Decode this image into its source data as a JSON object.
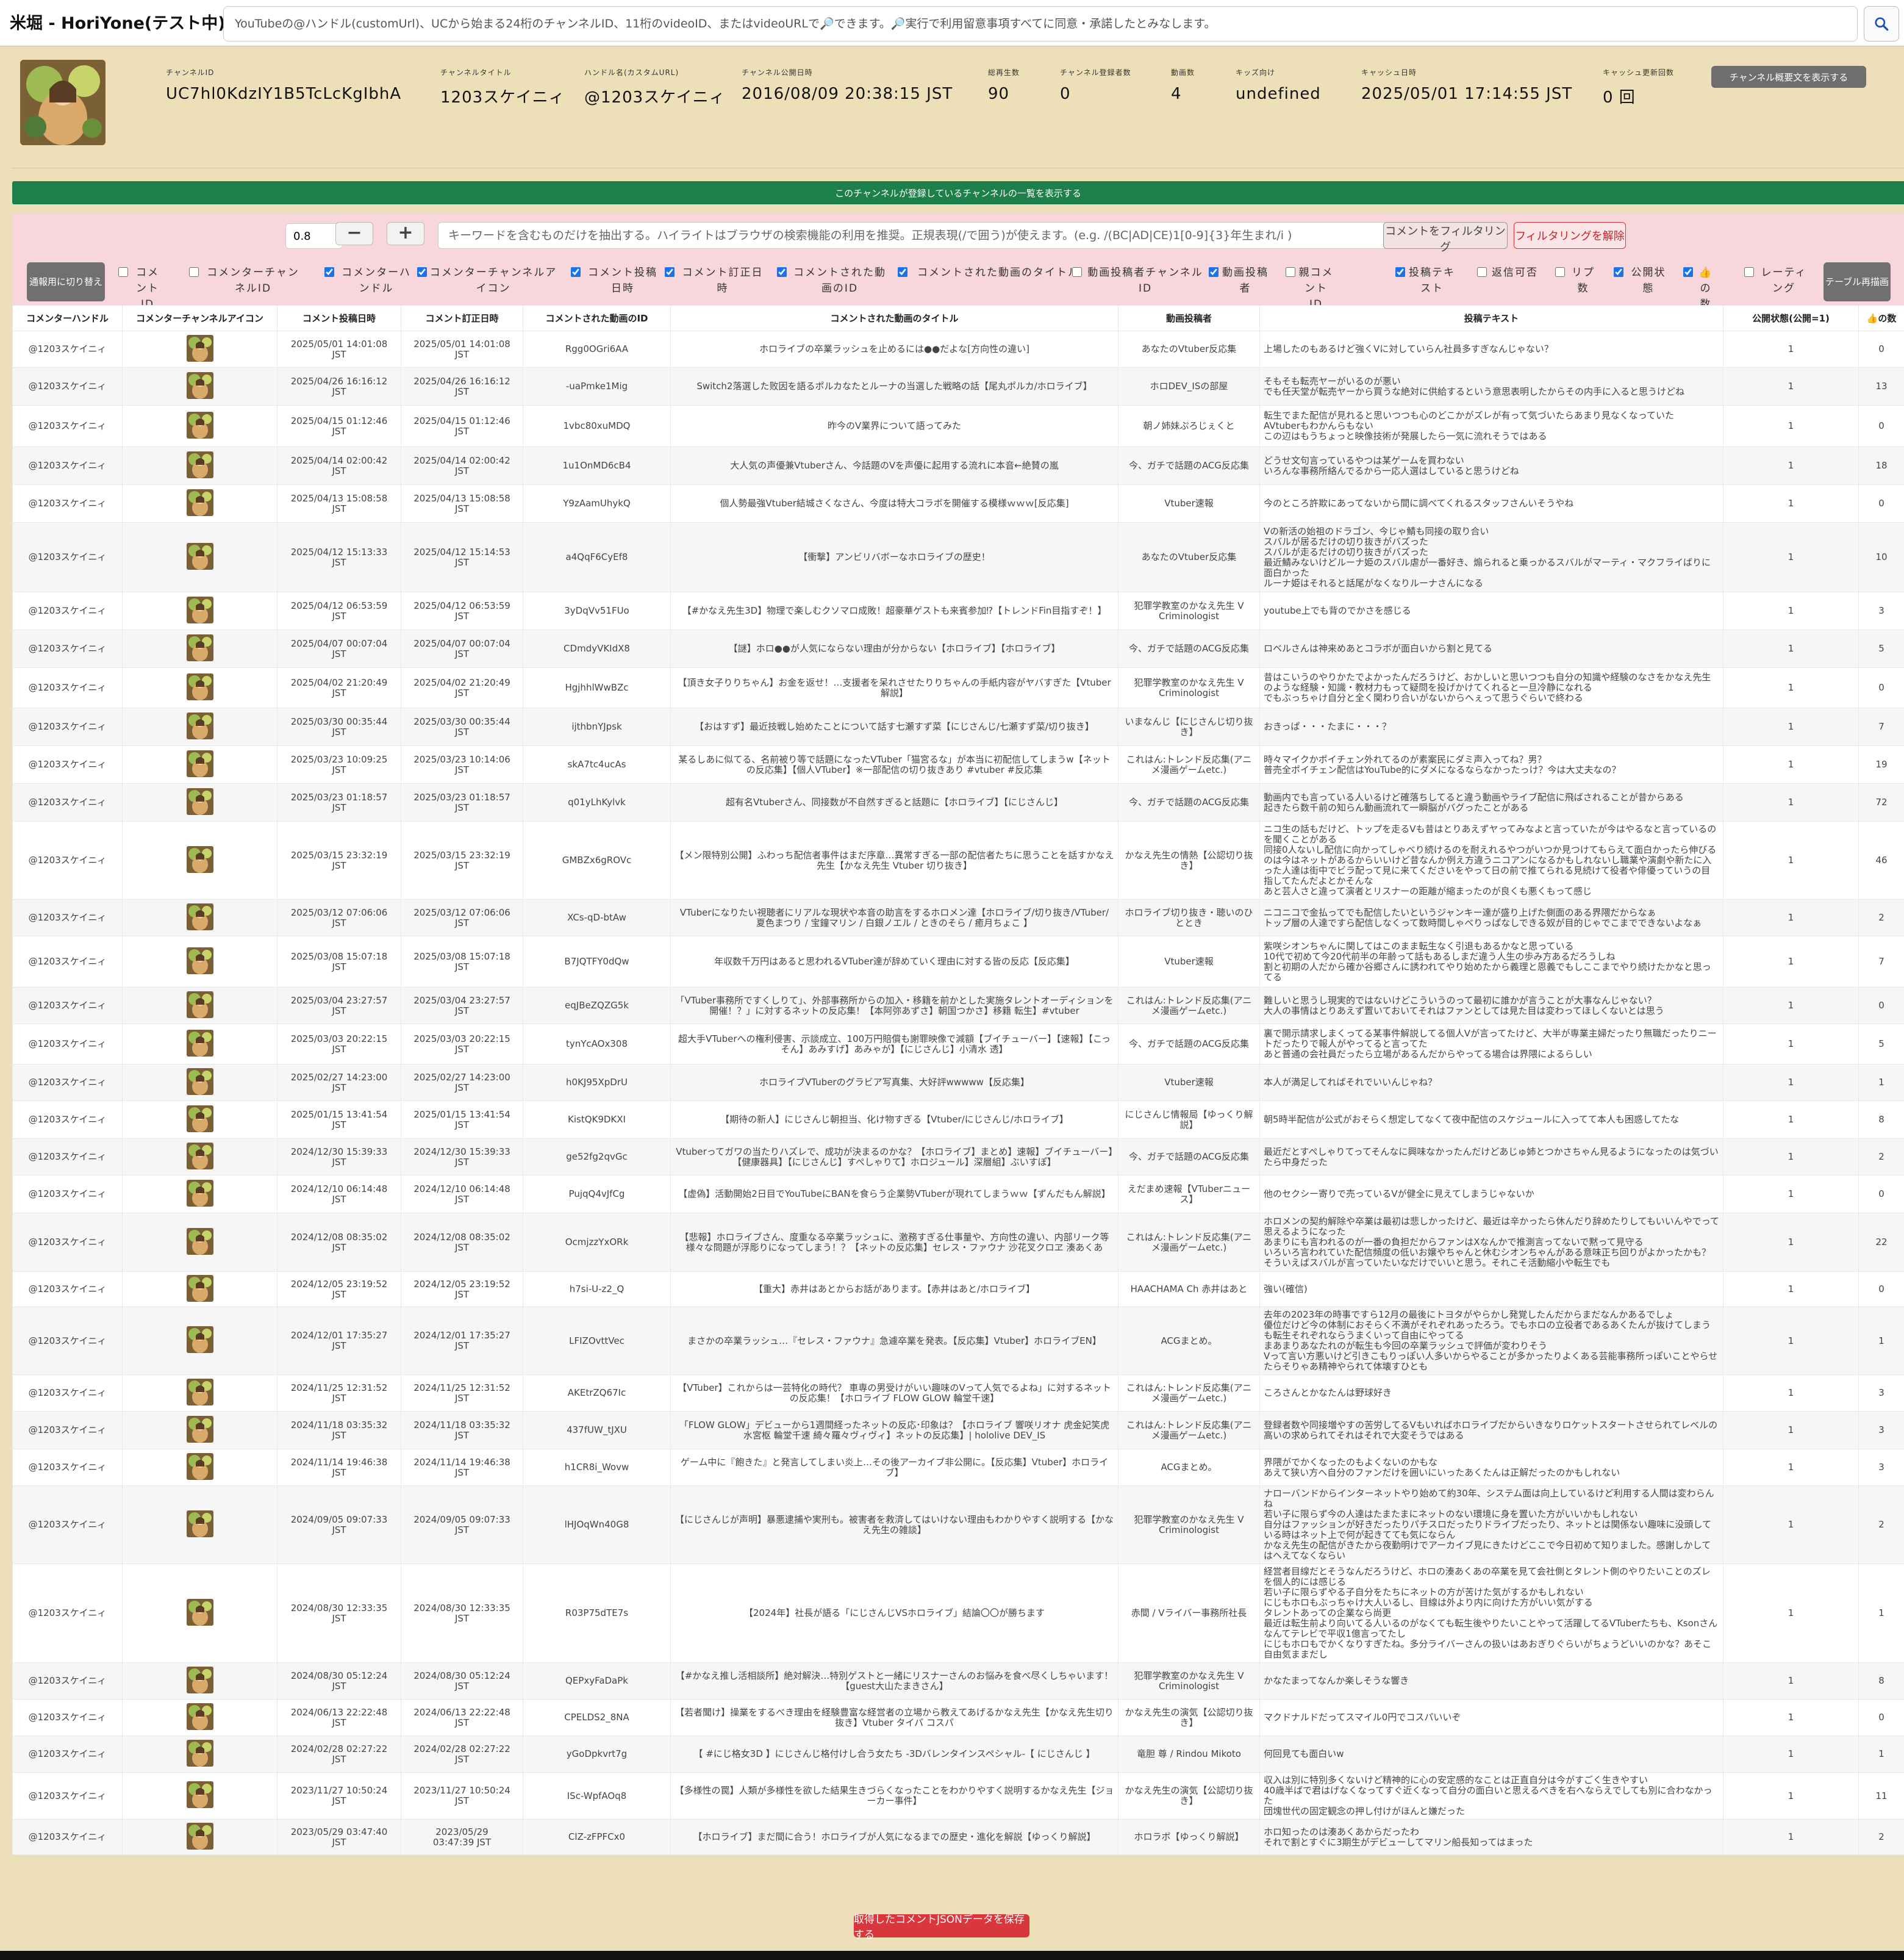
{
  "app": {
    "title": "米堀 - HoriYone(テスト中)"
  },
  "search": {
    "placeholder": "YouTubeの@ハンドル(customUrl)、UCから始まる24桁のチャンネルID、11桁のvideoID、またはvideoURLで🔎できます。🔎実行で利用留意事項すべてに同意・承諾したとみなします。",
    "icon": "search-icon"
  },
  "channel": {
    "fields": [
      {
        "label": "チャンネルID",
        "value": "UC7hl0KdzIY1B5TcLcKgIbhA"
      },
      {
        "label": "チャンネルタイトル",
        "value": "1203スケイニィ"
      },
      {
        "label": "ハンドル名(カスタムURL)",
        "value": "@1203スケイニィ"
      },
      {
        "label": "チャンネル公開日時",
        "value": "2016/08/09 20:38:15 JST"
      },
      {
        "label": "総再生数",
        "value": "90"
      },
      {
        "label": "チャンネル登録者数",
        "value": "0"
      },
      {
        "label": "動画数",
        "value": "4"
      },
      {
        "label": "キッズ向け",
        "value": "undefined"
      },
      {
        "label": "キャッシュ日時",
        "value": "2025/05/01 17:14:55 JST"
      },
      {
        "label": "キャッシュ更新回数",
        "value": "0 回"
      }
    ],
    "summary_button": "チャンネル概要文を表示する"
  },
  "subscriptions_bar": "このチャンネルが登録しているチャンネルの一覧を表示する",
  "filter": {
    "threshold": "0.8",
    "minus": "−",
    "plus": "+",
    "keyword_placeholder": "キーワードを含むものだけを抽出する。ハイライトはブラウザの検索機能の利用を推奨。正規表現(/で囲う)が使えます。(e.g. /(BC|AD|CE)1[0-9]{3}年生まれ/i )",
    "filter_button": "コメントをフィルタリング",
    "unfilter_button": "フィルタリングを解除",
    "print_button": "通報用に切り替え",
    "redraw_button": "テーブル再描画"
  },
  "column_toggles": [
    {
      "label": "コメントID",
      "checked": false
    },
    {
      "label": "コメンターチャンネルID",
      "checked": false
    },
    {
      "label": "コメンターハンドル",
      "checked": true
    },
    {
      "label": "コメンターチャンネルアイコン",
      "checked": true
    },
    {
      "label": "コメント投稿日時",
      "checked": true
    },
    {
      "label": "コメント訂正日時",
      "checked": true
    },
    {
      "label": "コメントされた動画のID",
      "checked": true
    },
    {
      "label": "コメントされた動画のタイトル",
      "checked": true
    },
    {
      "label": "動画投稿者チャンネルID",
      "checked": false
    },
    {
      "label": "動画投稿者",
      "checked": true
    },
    {
      "label": "親コメントID",
      "checked": false
    },
    {
      "label": "投稿テキスト",
      "checked": true
    },
    {
      "label": "返信可否",
      "checked": false
    },
    {
      "label": "リプ数",
      "checked": false
    },
    {
      "label": "公開状態",
      "checked": true
    },
    {
      "label": "👍の数",
      "checked": true
    },
    {
      "label": "レーティング",
      "checked": false
    }
  ],
  "table": {
    "headers": [
      "コメンターハンドル",
      "コメンターチャンネルアイコン",
      "コメント投稿日時",
      "コメント訂正日時",
      "コメントされた動画のID",
      "コメントされた動画のタイトル",
      "動画投稿者",
      "投稿テキスト",
      "公開状態(公開=1)",
      "👍の数"
    ],
    "rows": [
      {
        "handle": "@1203スケイニィ",
        "posted": "2025/05/01 14:01:08\nJST",
        "edited": "2025/05/01 14:01:08\nJST",
        "edited_red": false,
        "vid": "Rgg0OGri6AA",
        "title": "ホロライブの卒業ラッシュを止めるには●●だよな[方向性の違い]",
        "uploader": "あなたのVtuber反応集",
        "text": "上場したのもあるけど強くVに対していらん社員多すぎなんじゃない？",
        "pub": "1",
        "likes": "0"
      },
      {
        "handle": "@1203スケイニィ",
        "posted": "2025/04/26 16:16:12\nJST",
        "edited": "2025/04/26 16:16:12\nJST",
        "edited_red": false,
        "vid": "-uaPmke1Mig",
        "title": "Switch2落選した败因を語るポルカなたとルーナの当選した戦略の話【尾丸ポルカ/ホロライブ】",
        "uploader": "ホロDEV_ISの部屋",
        "text": "そもそも転売ヤーがいるのが悪い\nでも任天堂が転売ヤーから買うな絶対に供給するという意思表明したからその内手に入ると思うけどね",
        "pub": "1",
        "likes": "13"
      },
      {
        "handle": "@1203スケイニィ",
        "posted": "2025/04/15 01:12:46\nJST",
        "edited": "2025/04/15 01:12:46\nJST",
        "edited_red": false,
        "vid": "1vbc80xuMDQ",
        "title": "昨今のV業界について語ってみた",
        "uploader": "朝ノ姉妹ぷろじぇくと",
        "text": "転生でまた配信が見れると思いつつも心のどこかがズレが有って気づいたらあまり見なくなっていた\nAVtuberもわかんらもない\nこの辺はもうちょっと映像技術が発展したら一気に流れそうではある",
        "pub": "1",
        "likes": "0"
      },
      {
        "handle": "@1203スケイニィ",
        "posted": "2025/04/14 02:00:42\nJST",
        "edited": "2025/04/14 02:00:42\nJST",
        "edited_red": false,
        "vid": "1u1OnMD6cB4",
        "title": "大人気の声優兼Vtuberさん、今話題のVを声優に起用する流れに本音←絶賛の嵐",
        "uploader": "今、ガチで話題のACG反応集",
        "text": "どうせ文句言っているやつは某ゲームを買わない\nいろんな事務所絡んでるから一応人選はしていると思うけどね",
        "pub": "1",
        "likes": "18"
      },
      {
        "handle": "@1203スケイニィ",
        "posted": "2025/04/13 15:08:58\nJST",
        "edited": "2025/04/13 15:08:58\nJST",
        "edited_red": false,
        "vid": "Y9zAamUhykQ",
        "title": "個人勢最強Vtuber結城さくなさん、今度は特大コラボを開催する模様ｗｗｗ[反応集]",
        "uploader": "Vtuber速報",
        "text": "今のところ許欺にあってないから間に調べてくれるスタッフさんいそうやね",
        "pub": "1",
        "likes": "0"
      },
      {
        "handle": "@1203スケイニィ",
        "posted": "2025/04/12 15:13:33\nJST",
        "edited": "2025/04/12 15:14:53\nJST",
        "edited_red": true,
        "vid": "a4QqF6CyEf8",
        "title": "【衝撃】アンビリバボーなホロライブの歴史！",
        "uploader": "あなたのVtuber反応集",
        "text": "Vの新活の始祖のドラゴン、今じゃ鯖も同接の取り合い\nスバルが居るだけの切り抜きがバズった\nスバルが走るだけの切り抜きがバズった\n最近鯖みないけどルーナ姫のスバル虐が一番好き、煽られると乗っかるスバルがマーティ・マクフライばりに面白かった\nルーナ姫はそれると話尾がなくなりルーナさんになる",
        "pub": "1",
        "likes": "10"
      },
      {
        "handle": "@1203スケイニィ",
        "posted": "2025/04/12 06:53:59\nJST",
        "edited": "2025/04/12 06:53:59\nJST",
        "edited_red": false,
        "vid": "3yDqVv51FUo",
        "title": "【#かなえ先生3D】物理で楽しむクソマロ成敗！超豪華ゲストも来賓参加⁉【トレンドFin目指すぞ！】",
        "uploader": "犯罪学教室のかなえ先生 V Criminologist",
        "text": "youtube上でも背のでかさを感じる",
        "pub": "1",
        "likes": "3"
      },
      {
        "handle": "@1203スケイニィ",
        "posted": "2025/04/07 00:07:04\nJST",
        "edited": "2025/04/07 00:07:04\nJST",
        "edited_red": false,
        "vid": "CDmdyVKIdX8",
        "title": "【謎】ホロ●●が人気にならない理由が分からない【ホロライブ】【ホロライブ】",
        "uploader": "今、ガチで話題のACG反応集",
        "text": "ロベルさんは神来めあとコラボが面白いから割と見てる",
        "pub": "1",
        "likes": "5"
      },
      {
        "handle": "@1203スケイニィ",
        "posted": "2025/04/02 21:20:49\nJST",
        "edited": "2025/04/02 21:20:49\nJST",
        "edited_red": false,
        "vid": "HgjhhlWwBZc",
        "title": "【頂き女子りりちゃん】お金を返せ！…支援者を呆れさせたりりちゃんの手紙内容がヤバすぎた【Vtuber解説】",
        "uploader": "犯罪学教室のかなえ先生 V Criminologist",
        "text": "昔はこいうのやりかたでよかったんだろうけど、おかしいと思いつつも自分の知識や経験のなさをかなえ先生のような経験・知識・教材力もって疑問を投げかけてくれると一旦冷静になれる\nでもぶっちゃけ自分と全く関わり合いがないからへぇって思うぐらいで終わる",
        "pub": "1",
        "likes": "0"
      },
      {
        "handle": "@1203スケイニィ",
        "posted": "2025/03/30 00:35:44\nJST",
        "edited": "2025/03/30 00:35:44\nJST",
        "edited_red": false,
        "vid": "ijthbnYJpsk",
        "title": "【おはすず】最近技戦し始めたことについて話す七瀬すず菜【にじさんじ/七瀬すず菜/切り抜き】",
        "uploader": "いまなんじ【にじさんじ切り抜き】",
        "text": "おきっぱ・・・たまに・・・？",
        "pub": "1",
        "likes": "7"
      },
      {
        "handle": "@1203スケイニィ",
        "posted": "2025/03/23 10:09:25\nJST",
        "edited": "2025/03/23 10:14:06\nJST",
        "edited_red": true,
        "vid": "skA7tc4ucAs",
        "title": "某るしあに似てる、名前被り等で話題になったVTuber「猫宮るな」が本当に初配信してしまうw【ネットの反応集】【個人VTuber】※一部配信の切り抜きあり #vtuber #反応集",
        "uploader": "これはん:トレンド反応集(アニメ漫画ゲームetc.)",
        "text": "時々マイクかポイチェン外れてるのが素案民にダミ声入ってね？男？\n普売全ポイチェン配信はYouTube的にダメになるならなかったっけ？今は大丈夫なの？",
        "pub": "1",
        "likes": "19"
      },
      {
        "handle": "@1203スケイニィ",
        "posted": "2025/03/23 01:18:57\nJST",
        "edited": "2025/03/23 01:18:57\nJST",
        "edited_red": false,
        "vid": "q01yLhKylvk",
        "title": "超有名Vtuberさん、同接数が不自然すぎると話題に【ホロライブ】【にじさんじ】",
        "uploader": "今、ガチで話題のACG反応集",
        "text": "動画内でも言っている人いるけど確落ちしてると違う動画やライブ配信に飛ばされることが昔からある\n起きたら数千前の知らん動画流れて一瞬脳がバグったことがある",
        "pub": "1",
        "likes": "72"
      },
      {
        "handle": "@1203スケイニィ",
        "posted": "2025/03/15 23:32:19\nJST",
        "edited": "2025/03/15 23:32:19\nJST",
        "edited_red": false,
        "vid": "GMBZx6gROVc",
        "title": "【メン限特別公開】ふわっち配信者事件はまだ序章…異常すぎる一部の配信者たちに思うことを話すかなえ先生【かなえ先生 Vtuber 切り抜き】",
        "uploader": "かなえ先生の情熱【公認切り抜き】",
        "text": "ニコ生の話もだけど、トップを走るVも昔はとりあえずヤってみなよと言っていたが今はやるなと言っているのを聞くことがある\n同接0人ないし配信に向かってしゃべり続けるのを耐えれるやつがいつか見つけてもらえて面白かったら伸びるのは今はネットがあるからいいけど昔なんか例え方違うニコアンになるかもしれないし職業や演劇や新たに入った人達は街中でビラ配って見に来てくださいをやって日の前で推てられる見続けて役者や俳優っていうの目指してたんだよとかそんな\nあと芸人さと違って演者とリスナーの距離が縮まったのが良くも悪くもって感じ",
        "pub": "1",
        "likes": "46"
      },
      {
        "handle": "@1203スケイニィ",
        "posted": "2025/03/12 07:06:06\nJST",
        "edited": "2025/03/12 07:06:06\nJST",
        "edited_red": false,
        "vid": "XCs-qD-btAw",
        "title": "VTuberになりたい視聴者にリアルな現状や本音の助言をするホロメン達【ホロライブ/切り抜き/VTuber/ 夏色まつり / 宝鐘マリン / 白銀ノエル / ときのそら / 癒月ちょこ 】",
        "uploader": "ホロライブ切り抜き・聴いのひととき",
        "text": "ニコニコで金払ってでも配信したいというジャンキー達が盛り上げた側面のある界隈だからなぁ\nトップ層の人達ですら配信しなくって数時間しゃべりっぱなしできる奴が目的じゃでこまでできないよなぁ",
        "pub": "1",
        "likes": "2"
      },
      {
        "handle": "@1203スケイニィ",
        "posted": "2025/03/08 15:07:18\nJST",
        "edited": "2025/03/08 15:07:18\nJST",
        "edited_red": false,
        "vid": "B7JQTFY0dQw",
        "title": "年収数千万円はあると思われるVTuber達が辞めていく理由に対する皆の反応【反応集】",
        "uploader": "Vtuber速報",
        "text": "紫咲シオンちゃんに関してはこのまま転生なく引退もあるかなと思っている\n10代で初めて今20代前半の年齢って話もあるしまだ違う人生の歩み方あるだろうしね\n割と初期の人だから確か谷郷さんに誘われてやり始めたから義理と恩義でもしここまでやり続けたかなと思ってる",
        "pub": "1",
        "likes": "7"
      },
      {
        "handle": "@1203スケイニィ",
        "posted": "2025/03/04 23:27:57\nJST",
        "edited": "2025/03/04 23:27:57\nJST",
        "edited_red": false,
        "vid": "eqJBeZQZG5k",
        "title": "「VTuber事務所ですくしりて」、外部事務所からの加入・移籍を前かとした実施タレントオーディションを開催！？」に対するネットの反応集！【本阿弥あずさ】朝国つかさ】移籍 転生】#vtuber",
        "uploader": "これはん:トレンド反応集(アニメ漫画ゲームetc.)",
        "text": "難しいと思うし現実的ではないけどこういうのって最初に誰かが言うことが大事なんじゃない？\n大人の事情はとりあえず置いておいてそれはファンとしては見た目は変わってほしくないとは思う",
        "pub": "1",
        "likes": "0"
      },
      {
        "handle": "@1203スケイニィ",
        "posted": "2025/03/03 20:22:15\nJST",
        "edited": "2025/03/03 20:22:15\nJST",
        "edited_red": false,
        "vid": "tynYcAOx308",
        "title": "超大手VTuberへの権利侵害、示談成立、100万円賠償も謝罪映像で減額【ブイチューバー】【速報】【こっそん】あみすげ】あみゃが】【にじさんじ】小清水 透】",
        "uploader": "今、ガチで話題のACG反応集",
        "text": "裏で開示請求しまくってる某事件解説してる個人Vが言ってたけど、大半が専業主婦だったり無職だったりニートだったりで報人がやってると言ってた\nあと普通の会社員だったら立場があるんだからやってる場合は界隈によるらしい",
        "pub": "1",
        "likes": "5"
      },
      {
        "handle": "@1203スケイニィ",
        "posted": "2025/02/27 14:23:00\nJST",
        "edited": "2025/02/27 14:23:00\nJST",
        "edited_red": false,
        "vid": "h0KJ95XpDrU",
        "title": "ホロライブVTuberのグラビア写真集、大好評wwwww【反応集】",
        "uploader": "Vtuber速報",
        "text": "本人が満足してればそれでいいんじゃね？",
        "pub": "1",
        "likes": "1"
      },
      {
        "handle": "@1203スケイニィ",
        "posted": "2025/01/15 13:41:54\nJST",
        "edited": "2025/01/15 13:41:54\nJST",
        "edited_red": false,
        "vid": "KistQK9DKXI",
        "title": "【期待の新人】にじさんじ朝担当、化け物すぎる【Vtuber/にじさんじ/ホロライブ】",
        "uploader": "にじさんじ情報局【ゆっくり解説】",
        "text": "朝5時半配信が公式がおそらく想定してなくて夜中配信のスケジュールに入ってて本人も困惑してたな",
        "pub": "1",
        "likes": "8"
      },
      {
        "handle": "@1203スケイニィ",
        "posted": "2024/12/30 15:39:33\nJST",
        "edited": "2024/12/30 15:39:33\nJST",
        "edited_red": false,
        "vid": "ge52fg2qvGc",
        "title": "Vtuberってガワの当たりハズレで、成功が決まるのかな？【ホロライブ】まとめ】速報】ブイチューバー】【健康器具】【にじさんじ】すぺしゃりて】ホロジュール】深層組】ぶいすぽ】",
        "uploader": "今、ガチで話題のACG反応集",
        "text": "最近だとすぺしゃりてってそんなに興味なかったんだけどあじゅ姉とつかさちゃん見るようになったのは気づいたら中身だった",
        "pub": "1",
        "likes": "2"
      },
      {
        "handle": "@1203スケイニィ",
        "posted": "2024/12/10 06:14:48\nJST",
        "edited": "2024/12/10 06:14:48\nJST",
        "edited_red": false,
        "vid": "PujqQ4vJfCg",
        "title": "【虚偽】活動開始2日目でYouTubeにBANを食らう企業勢VTuberが現れてしまうｗｗ【ずんだもん解説】",
        "uploader": "えだまめ速報【VTuberニュース】",
        "text": "他のセクシー寄りで売っているVが健全に見えてしまうじゃないか",
        "pub": "1",
        "likes": "0"
      },
      {
        "handle": "@1203スケイニィ",
        "posted": "2024/12/08 08:35:02\nJST",
        "edited": "2024/12/08 08:35:02\nJST",
        "edited_red": false,
        "vid": "OcmjzzYxORk",
        "title": "【悲報】ホロライブさん、度重なる卒業ラッシュに、激務すぎる仕事量や、方向性の違い、内部リーク等様々な問題が浮彫りになってしまう！？【ネットの反応集】セレス・ファウナ 沙花叉クロヱ 湊あくあ",
        "uploader": "これはん:トレンド反応集(アニメ漫画ゲームetc.)",
        "text": "ホロメンの契約解除や卒業は最初は悲しかったけど、最近は辛かったら休んだり辞めたりしてもいいんやでって思えるようになった\nあまりにも言われるのが一番の負担だからファンはXなんかで推測言ってないで黙って見守る\nいろいろ言われていた配信頻度の低いお嬢やちゃんと休むシオンちゃんがある意味正ち回りがよかったかも？\nそういえばスバルが言っていたいなだけでいいと思う。それこそ活動縮小や転生でも",
        "pub": "1",
        "likes": "22"
      },
      {
        "handle": "@1203スケイニィ",
        "posted": "2024/12/05 23:19:52\nJST",
        "edited": "2024/12/05 23:19:52\nJST",
        "edited_red": false,
        "vid": "h7si-U-z2_Q",
        "title": "【重大】赤井はあとからお話があります。【赤井はあと/ホロライブ】",
        "uploader": "HAACHAMA Ch 赤井はあと",
        "text": "強い(確信)",
        "pub": "1",
        "likes": "0"
      },
      {
        "handle": "@1203スケイニィ",
        "posted": "2024/12/01 17:35:27\nJST",
        "edited": "2024/12/01 17:35:27\nJST",
        "edited_red": false,
        "vid": "LFIZOvttVec",
        "title": "まさかの卒業ラッシュ…『セレス・ファウナ』急遽卒業を発表。【反応集】Vtuber】ホロライブEN】",
        "uploader": "ACGまとめ。",
        "text": "去年の2023年の時事ですら12月の最後にトヨタがやらかし発覚したんだからまだなんかあるでしょ\n優位だけど今の体制におそらく不満がそれぞれあったろう。でもホロの立役者であるあくたんが抜けてしまう\nも転生それぞれならうまくいって自由にやってる\nまあまりあなたれのが転生も今回の卒業ラッシュで評価が変わりそう\nVって言い方悪いけど引きこもりっぽい人多いからやることが多かったりよくある芸能事務所っぽいことやらせたらそりゃあ精神やられて体壊すひとも",
        "pub": "1",
        "likes": "1"
      },
      {
        "handle": "@1203スケイニィ",
        "posted": "2024/11/25 12:31:52\nJST",
        "edited": "2024/11/25 12:31:52\nJST",
        "edited_red": false,
        "vid": "AKEtrZQ67Ic",
        "title": "【VTuber】これからは一芸特化の時代？ 車専の男受けがいい趣味のVって人気でるよね」に対するネットの反応集！【ホロライブ FLOW GLOW 輪堂千速】",
        "uploader": "これはん:トレンド反応集(アニメ漫画ゲームetc.)",
        "text": "ころさんとかなたんは野球好き",
        "pub": "1",
        "likes": "3"
      },
      {
        "handle": "@1203スケイニィ",
        "posted": "2024/11/18 03:35:32\nJST",
        "edited": "2024/11/18 03:35:32\nJST",
        "edited_red": false,
        "vid": "437fUW_tJXU",
        "title": "「FLOW GLOW」デビューから1週間経ったネットの反応･印象は？【ホロライブ 響咲リオナ 虎金妃笑虎 水宮枢 輪堂千速 綺々羅々ヴィヴィ】ネットの反応集】| hololive DEV_IS",
        "uploader": "これはん:トレンド反応集(アニメ漫画ゲームetc.)",
        "text": "登録者数や同接増やすの苦労してるVもいればホロライブだからいきなりロケットスタートさせられてレベルの高いの求められてそれはそれで大変そうではある",
        "pub": "1",
        "likes": "3"
      },
      {
        "handle": "@1203スケイニィ",
        "posted": "2024/11/14 19:46:38\nJST",
        "edited": "2024/11/14 19:46:38\nJST",
        "edited_red": false,
        "vid": "h1CR8i_Wovw",
        "title": "ゲーム中に『飽きた』と発言してしまい炎上…その後アーカイブ非公開に。【反応集】Vtuber】ホロライブ】",
        "uploader": "ACGまとめ。",
        "text": "界隈がでかくなったのもよくないのかもな\nあえて狭い方へ自分のファンだけを囲いにいったあくたんは正解だったのかもしれない",
        "pub": "1",
        "likes": "3"
      },
      {
        "handle": "@1203スケイニィ",
        "posted": "2024/09/05 09:07:33\nJST",
        "edited": "2024/09/05 09:07:33\nJST",
        "edited_red": false,
        "vid": "lHJOqWn40G8",
        "title": "【にじさんじが声明】暴悪逮捕や実刑も。被害者を救済してはいけない理由もわかりやすく説明する【かなえ先生の雑談】",
        "uploader": "犯罪学教室のかなえ先生 V Criminologist",
        "text": "ナローバンドからインターネットやり始めて約30年、システム面は向上しているけど利用する人間は変わらんね\n若い子に限らず今の人達はたまたまにネットのない環境に身を置いた方がいいかもしれない\n自分はファッションが好きだったりパチスロだったりドライブだったり、ネットとは関係ない趣味に没頭している時はネット上で何が起きてても気にならん\nかなえ先生の配信がきたから夜勤明けでアーカイブ見にきたけどここで今日初めて知りました。感謝しかしてはへえてなくならい",
        "pub": "1",
        "likes": "2"
      },
      {
        "handle": "@1203スケイニィ",
        "posted": "2024/08/30 12:33:35\nJST",
        "edited": "2024/08/30 12:33:35\nJST",
        "edited_red": false,
        "vid": "R03P75dTE7s",
        "title": "【2024年】社長が語る「にじさんじVSホロライブ」結論〇〇が勝ちます",
        "uploader": "赤間 / Vライバー事務所社長",
        "text": "経営者目線だとそうなんだろうけど、ホロの湊あくあの卒業を見て会社側とタレント側のやりたいことのズレを個人的には感じる\n若い子に限らずやる子自分をたちにネットの方が苦けた気がするかもしれない\nにじもホロもぶっちゃけ大人いるし、目線は外より内に向けた方がいい気がする\nタレントあっての企業なら尚更\n最近は転生前より向いてる人いるのがなくても転生後やりたいことやって活躍してるVTuberたちも、Ksonさんなんてテレビで平収1億言ってたし\nにじもホロもでかくなりすぎたね。多分ライバーさんの扱いはあおぎりぐらいがちょうどいいのかな？あそこ自由気ままだし",
        "pub": "1",
        "likes": "1"
      },
      {
        "handle": "@1203スケイニィ",
        "posted": "2024/08/30 05:12:24\nJST",
        "edited": "2024/08/30 05:12:24\nJST",
        "edited_red": false,
        "vid": "QEPxyFaDaPk",
        "title": "【#かなえ推し活相談所】絶対解決…特別ゲストと一緒にリスナーさんのお悩みを食べ尽くしちゃいます！【guest大山たまきさん】",
        "uploader": "犯罪学教室のかなえ先生 V Criminologist",
        "text": "かなたまってなんか楽しそうな響き",
        "pub": "1",
        "likes": "8"
      },
      {
        "handle": "@1203スケイニィ",
        "posted": "2024/06/13 22:22:48\nJST",
        "edited": "2024/06/13 22:22:48\nJST",
        "edited_red": false,
        "vid": "CPELDS2_8NA",
        "title": "【若者聞け】操業をするべき理由を経験豊富な経営者の立場から教えてあげるかなえ先生【かなえ先生切り抜き】Vtuber タイパ コスパ",
        "uploader": "かなえ先生の演気【公認切り抜き】",
        "text": "マクドナルドだってスマイル0円でコスパいいぞ",
        "pub": "1",
        "likes": "0"
      },
      {
        "handle": "@1203スケイニィ",
        "posted": "2024/02/28 02:27:22\nJST",
        "edited": "2024/02/28 02:27:22\nJST",
        "edited_red": false,
        "vid": "yGoDpkvrt7g",
        "title": "【 #にじ格女3D 】にじさんじ格付けし合う女たち -3Dバレンタインスペシャル-【 にじさんじ 】",
        "uploader": "竜胆 尊 / Rindou Mikoto",
        "text": "何回見ても面白いw",
        "pub": "1",
        "likes": "1"
      },
      {
        "handle": "@1203スケイニィ",
        "posted": "2023/11/27 10:50:24\nJST",
        "edited": "2023/11/27 10:50:24\nJST",
        "edited_red": false,
        "vid": "ISc-WpfAOq8",
        "title": "【多様性の罠】人類が多様性を欲した結果生きづらくなったことをわかりやすく説明するかなえ先生【ジョーカー事件】",
        "uploader": "かなえ先生の演気【公認切り抜き】",
        "text": "収入は別に特別多くないけど精神的に心の安定感的なことは正直自分は今がすごく生きやすい\n40歳半ばで君はげなくなってすぐ近くなって自分の面白いと思えるべきを右へならえでしても別に合わなかった\n団塊世代の固定観念の押し付けがほんと嫌だった",
        "pub": "1",
        "likes": "11"
      },
      {
        "handle": "@1203スケイニィ",
        "posted": "2023/05/29 03:47:40\nJST",
        "edited": "2023/05/29\n03:47:39 JST",
        "edited_red": true,
        "vid": "ClZ-zFPFCx0",
        "title": "【ホロライブ】まだ間に合う！ホロライブが人気になるまでの歴史・進化を解説【ゆっくり解説】",
        "uploader": "ホロラボ【ゆっくり解説】",
        "text": "ホロ知ったのは湊あくあからだったわ\nそれで割とすぐに3期生がデビューしてマリン船長知ってはまった",
        "pub": "1",
        "likes": "2"
      }
    ]
  },
  "save_button": "取得したコメントJSONデータを保存する",
  "colors": {
    "bg": "#ede0b8",
    "green": "#1d7f4a",
    "pink": "#f7d6dc",
    "red": "#d9363e",
    "edited_red": "#d22"
  }
}
